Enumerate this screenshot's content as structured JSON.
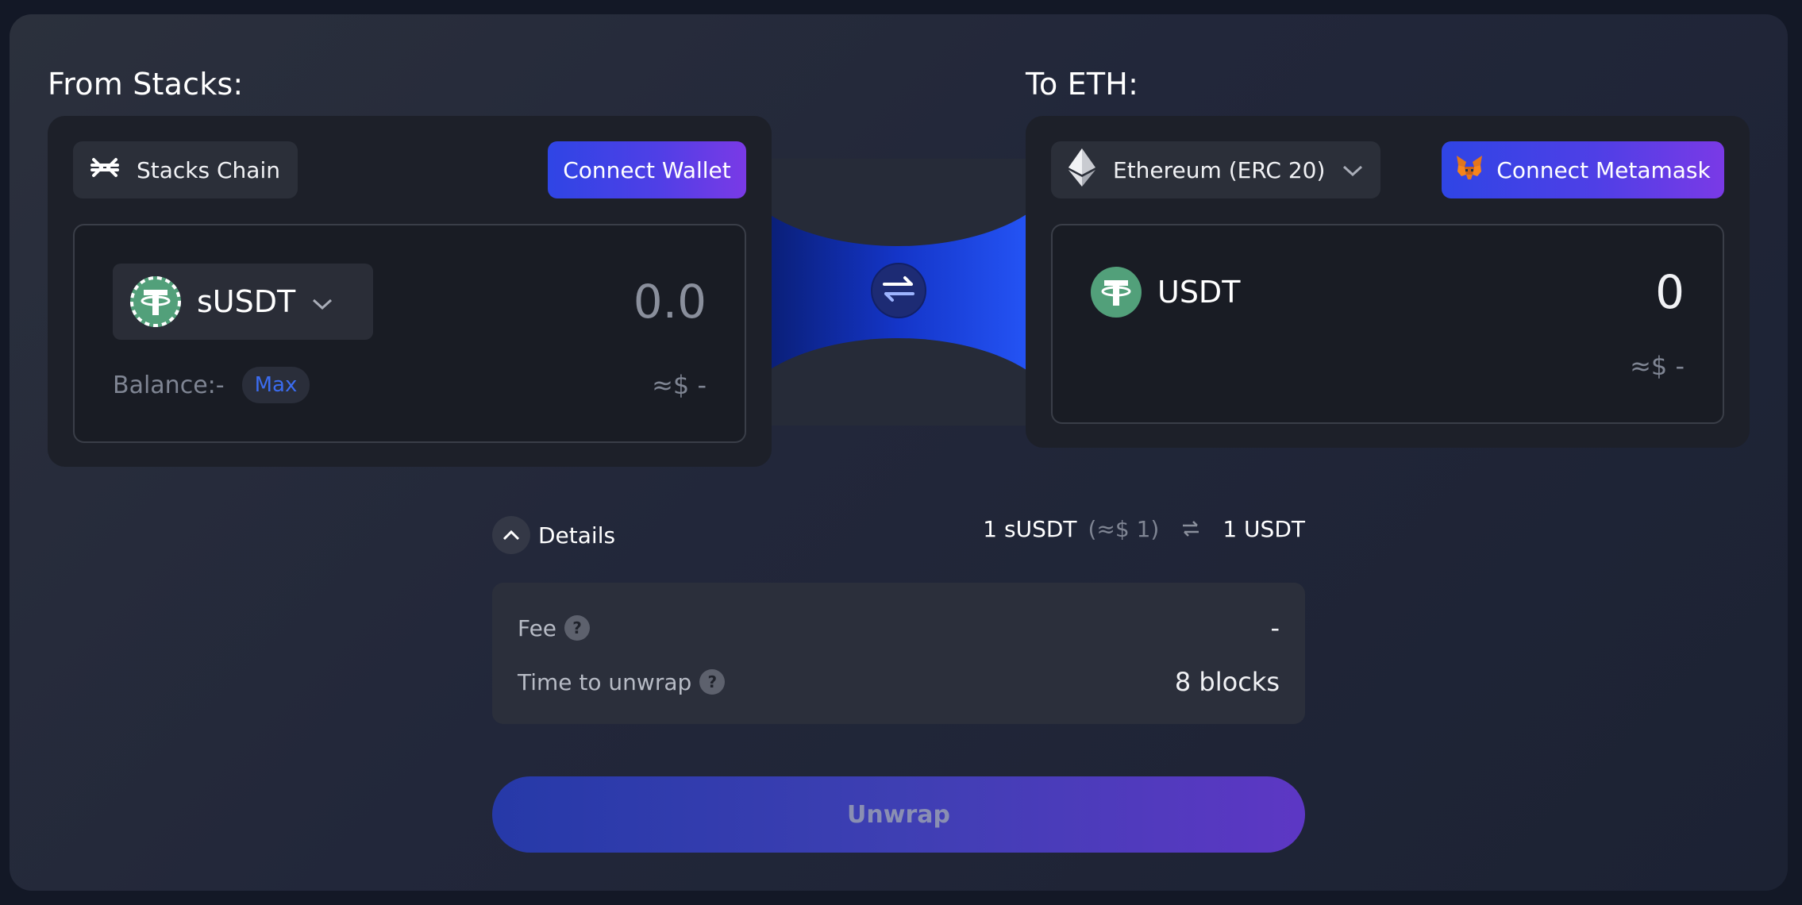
{
  "from": {
    "title": "From Stacks:",
    "chain_label": "Stacks Chain",
    "connect_label": "Connect Wallet",
    "token": "sUSDT",
    "amount": "0.0",
    "balance_label": "Balance:-",
    "max_label": "Max",
    "usd_value": "≈$ -"
  },
  "to": {
    "title": "To ETH:",
    "chain_label": "Ethereum (ERC 20)",
    "connect_label": "Connect Metamask",
    "token": "USDT",
    "amount": "0",
    "usd_value": "≈$ -"
  },
  "details": {
    "label": "Details",
    "rate_from": "1 sUSDT",
    "rate_from_usd": "(≈$ 1)",
    "rate_to": "1 USDT",
    "fee_label": "Fee",
    "fee_value": "-",
    "time_label": "Time to unwrap",
    "time_value": "8 blocks"
  },
  "action": {
    "unwrap_label": "Unwrap"
  },
  "colors": {
    "accent_start": "#2f45e5",
    "accent_end": "#7a3ae6",
    "tether_green": "#52a07a",
    "max_blue": "#3b6cf0"
  },
  "icons": {
    "stacks": "stacks-icon",
    "ethereum": "ethereum-icon",
    "metamask": "metamask-icon",
    "tether": "tether-icon",
    "swap": "swap-arrows-icon",
    "chevron_down": "chevron-down-icon",
    "chevron_up": "chevron-up-icon",
    "help": "help-icon"
  }
}
